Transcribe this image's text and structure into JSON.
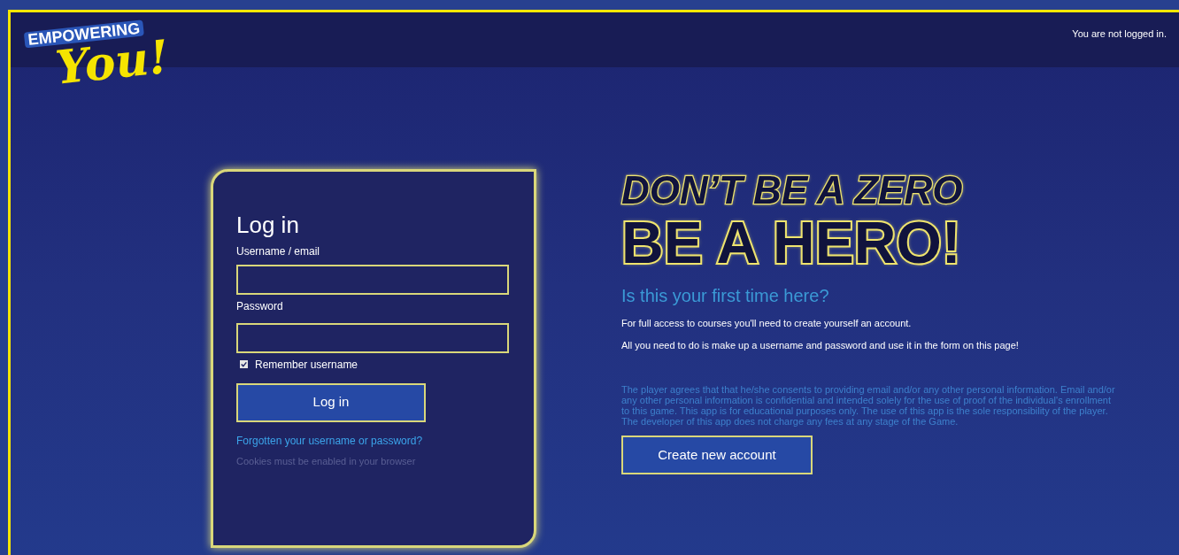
{
  "logo": {
    "line_1": "EMPOWERING",
    "line_2": "You!"
  },
  "header": {
    "login_status": "You are not logged in."
  },
  "login": {
    "title": "Log in",
    "username_label": "Username / email",
    "password_label": "Password",
    "remember": {
      "label": "Remember username",
      "checked": true
    },
    "submit": "Log in",
    "forgot_link": "Forgotten your username or password?",
    "cookies_note": "Cookies must be enabled in your browser"
  },
  "signup": {
    "slogan_1": "DON’T BE A ZERO",
    "slogan_2": "BE A HERO!",
    "heading": "Is this your first time here?",
    "paragraphs": [
      "For full access to courses you'll need to create yourself an account.",
      "All you need to do is make up a username and password and use it in the form on this page!"
    ],
    "disclaimer": "The player agrees that that he/she consents to providing email and/or any other personal information. Email and/or any other personal information is confidential and intended solely for the use of proof of the individual's enrollment to this game. This app is for educational purposes only. The use of this app is the sole responsibility of the player. The developer of this app does not charge any fees at any stage of the Game.",
    "button": "Create new account"
  }
}
